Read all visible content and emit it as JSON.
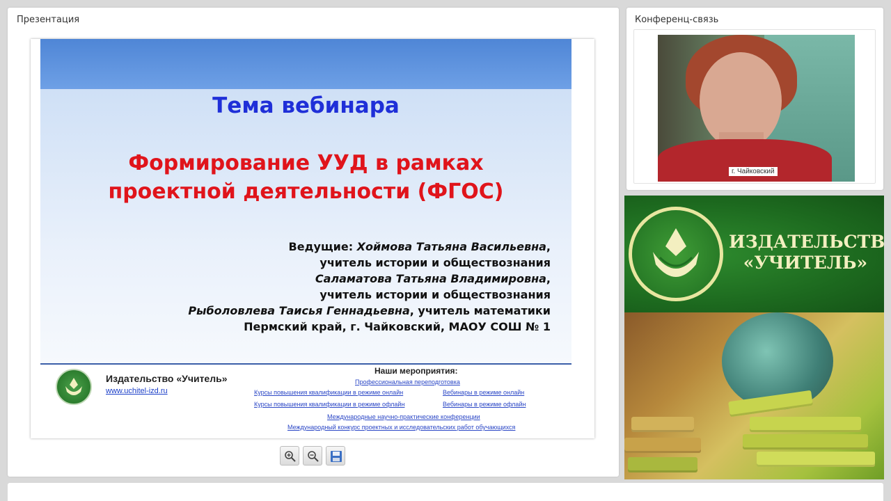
{
  "panels": {
    "presentation_title": "Презентация",
    "conference_title": "Конференц-связь"
  },
  "slide": {
    "webinar_theme": "Тема вебинара",
    "topic_line1": "Формирование УУД в рамках",
    "topic_line2": "проектной деятельности (ФГОС)",
    "hosts": {
      "label": "Ведущие:",
      "host1_name": "Хоймова Татьяна Васильевна",
      "host1_role": "учитель истории и обществознания",
      "host2_name": "Саламатова Татьяна Владимировна",
      "host2_role": "учитель истории и обществознания",
      "host3_name": "Рыболовлева Таисья Геннадьевна",
      "host3_role": ", учитель математики",
      "location": "Пермский край, г. Чайковский, МАОУ СОШ  № 1"
    },
    "footer": {
      "publisher": "Издательство «Учитель»",
      "url": "www.uchitel-izd.ru",
      "events_title": "Наши мероприятия:",
      "events": [
        "Профессиональная переподготовка",
        "Курсы повышения квалификации в режиме онлайн",
        "Вебинары в режиме онлайн",
        "Курсы повышения квалификации в режиме офлайн",
        "Вебинары в режиме офлайн",
        "Международные научно-практические конференции",
        "Международный конкурс проектных и исследовательских работ обучающихся"
      ]
    }
  },
  "toolbar": {
    "zoom_in_icon": "zoom-in-icon",
    "zoom_out_icon": "zoom-out-icon",
    "save_icon": "save-icon"
  },
  "video": {
    "caption": "г. Чайковский"
  },
  "banner": {
    "title_line1": "ИЗДАТЕЛЬСТВО",
    "title_line2": "«УЧИТЕЛЬ»"
  },
  "colors": {
    "theme_blue": "#1f2fd8",
    "topic_red": "#e0141b",
    "link_blue": "#2b47c6",
    "banner_green": "#1d6a1f"
  }
}
